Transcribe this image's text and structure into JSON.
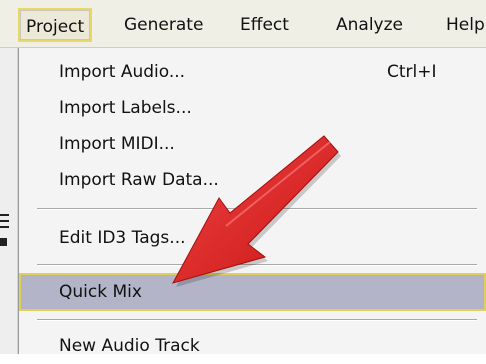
{
  "menubar": {
    "items": [
      {
        "label": "Project"
      },
      {
        "label": "Generate"
      },
      {
        "label": "Effect"
      },
      {
        "label": "Analyze"
      },
      {
        "label": "Help"
      }
    ]
  },
  "menu": {
    "items": [
      {
        "label": "Import Audio...",
        "shortcut": "Ctrl+I"
      },
      {
        "label": "Import Labels..."
      },
      {
        "label": "Import MIDI..."
      },
      {
        "label": "Import Raw Data..."
      },
      {
        "label": "Edit ID3 Tags..."
      },
      {
        "label": "Quick Mix",
        "highlighted": true
      },
      {
        "label": "New Audio Track"
      }
    ]
  },
  "annotation": {
    "arrow_color": "#e01d1d",
    "icon": "red-arrow-pointer"
  },
  "colors": {
    "menu_bg": "#f4f4f4",
    "highlight_bg": "#b4b4c8",
    "highlight_border": "#e0cf5a"
  }
}
